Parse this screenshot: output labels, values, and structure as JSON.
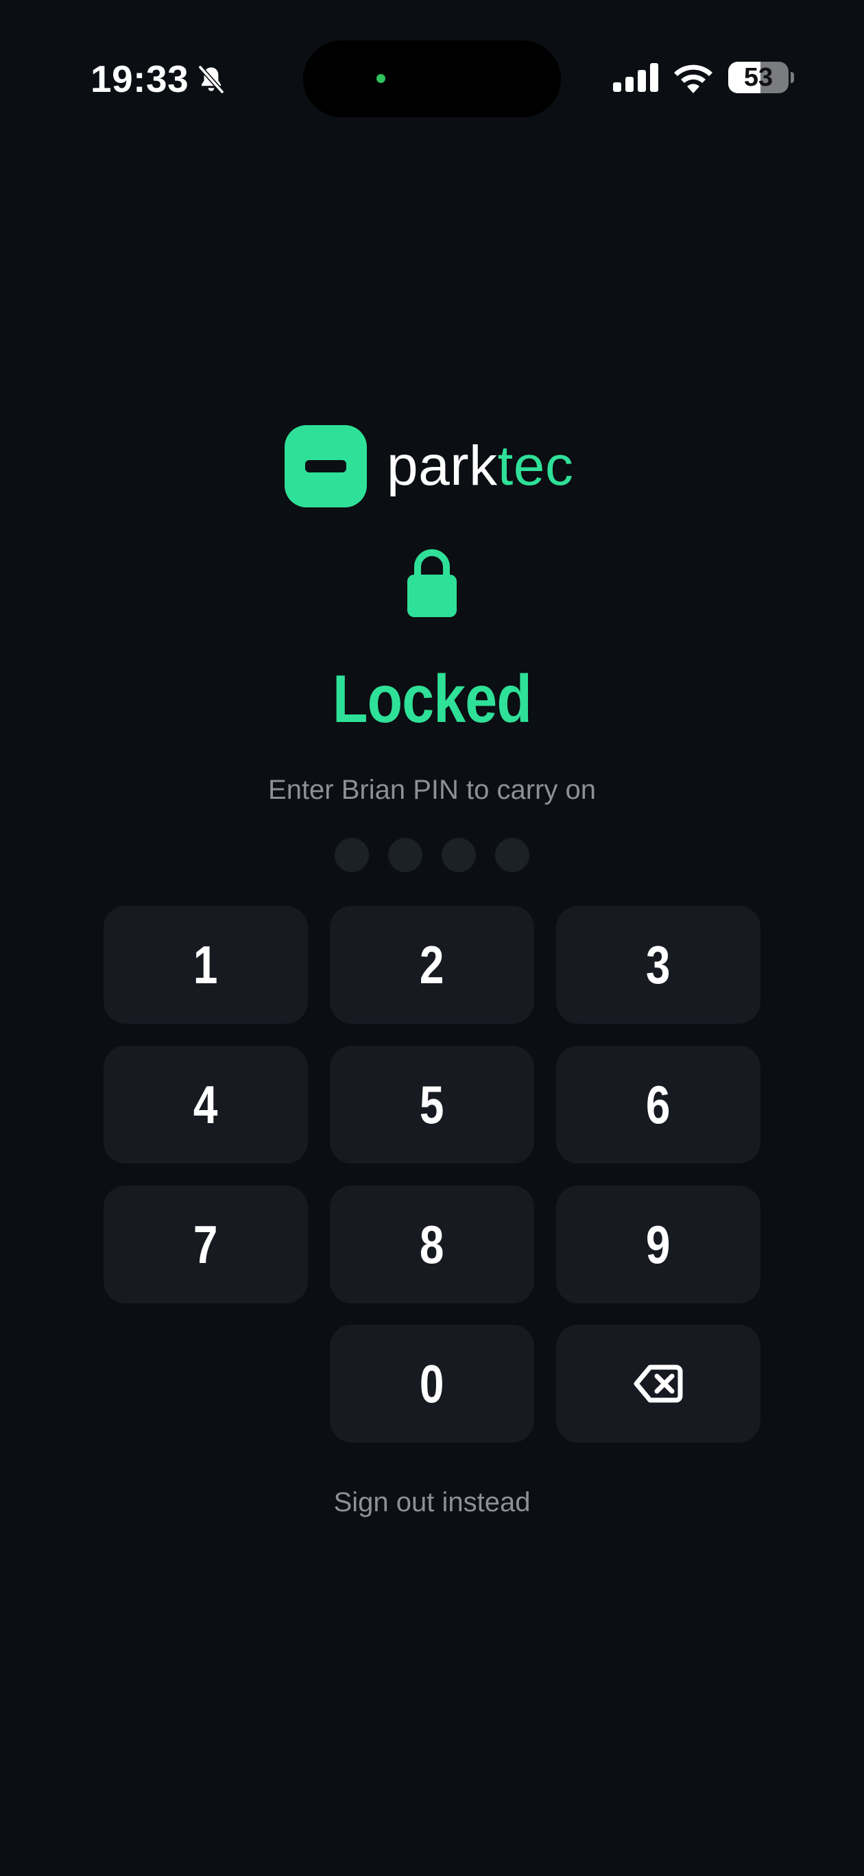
{
  "status_bar": {
    "time": "19:33",
    "silent_icon": "bell-slash-icon",
    "signal_icon": "cellular-signal-icon",
    "wifi_icon": "wifi-icon",
    "battery_level": "53",
    "battery_fraction": 0.53
  },
  "brand": {
    "name_primary": "park",
    "name_accent": "tec",
    "logo_icon": "parktec-logo-icon"
  },
  "lock_screen": {
    "lock_icon": "padlock-icon",
    "title": "Locked",
    "subtitle": "Enter Brian PIN to carry on",
    "pin_length": 4,
    "pin_entered": 0
  },
  "keypad": {
    "keys": [
      "1",
      "2",
      "3",
      "4",
      "5",
      "6",
      "7",
      "8",
      "9",
      "0"
    ],
    "backspace_icon": "backspace-icon"
  },
  "footer": {
    "sign_out_label": "Sign out instead"
  },
  "colors": {
    "background": "#0b0e12",
    "accent": "#2fe098",
    "key_background": "#171a21",
    "muted_text": "#8d9097",
    "pin_dot_empty": "#1c2027"
  }
}
